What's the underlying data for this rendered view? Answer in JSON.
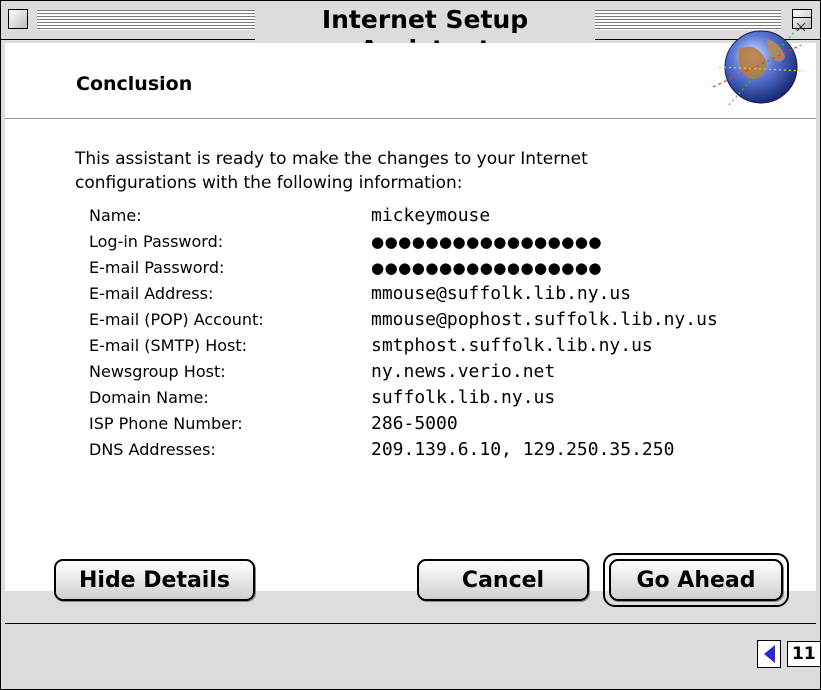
{
  "window": {
    "title": "Internet Setup Assistant"
  },
  "header": {
    "section_title": "Conclusion"
  },
  "intro": {
    "line1": "This assistant is ready to make the changes to your Internet",
    "line2": "configurations with the following information:"
  },
  "details": [
    {
      "label": "Name:",
      "value": "mickeymouse"
    },
    {
      "label": "Log-in Password:",
      "value": "●●●●●●●●●●●●●●●●●"
    },
    {
      "label": "E-mail Password:",
      "value": "●●●●●●●●●●●●●●●●●"
    },
    {
      "label": "E-mail Address:",
      "value": "mmouse@suffolk.lib.ny.us"
    },
    {
      "label": "E-mail (POP) Account:",
      "value": "mmouse@pophost.suffolk.lib.ny.us"
    },
    {
      "label": "E-mail (SMTP) Host:",
      "value": "smtphost.suffolk.lib.ny.us"
    },
    {
      "label": "Newsgroup Host:",
      "value": "ny.news.verio.net"
    },
    {
      "label": "Domain Name:",
      "value": "suffolk.lib.ny.us"
    },
    {
      "label": "ISP Phone Number:",
      "value": "286-5000"
    },
    {
      "label": "DNS Addresses:",
      "value": "209.139.6.10, 129.250.35.250"
    }
  ],
  "buttons": {
    "hide_details": "Hide Details",
    "cancel": "Cancel",
    "go_ahead": "Go Ahead"
  },
  "navigation": {
    "page": "11",
    "prev_icon": "triangle-left-icon",
    "next_icon": "triangle-right-icon"
  },
  "icons": {
    "globe": "internet-globe-icon",
    "close": "close-box-icon",
    "zoom": "zoom-box-icon"
  },
  "colors": {
    "nav_active": "#2a2ad0",
    "nav_inactive": "#9aa6e0"
  }
}
